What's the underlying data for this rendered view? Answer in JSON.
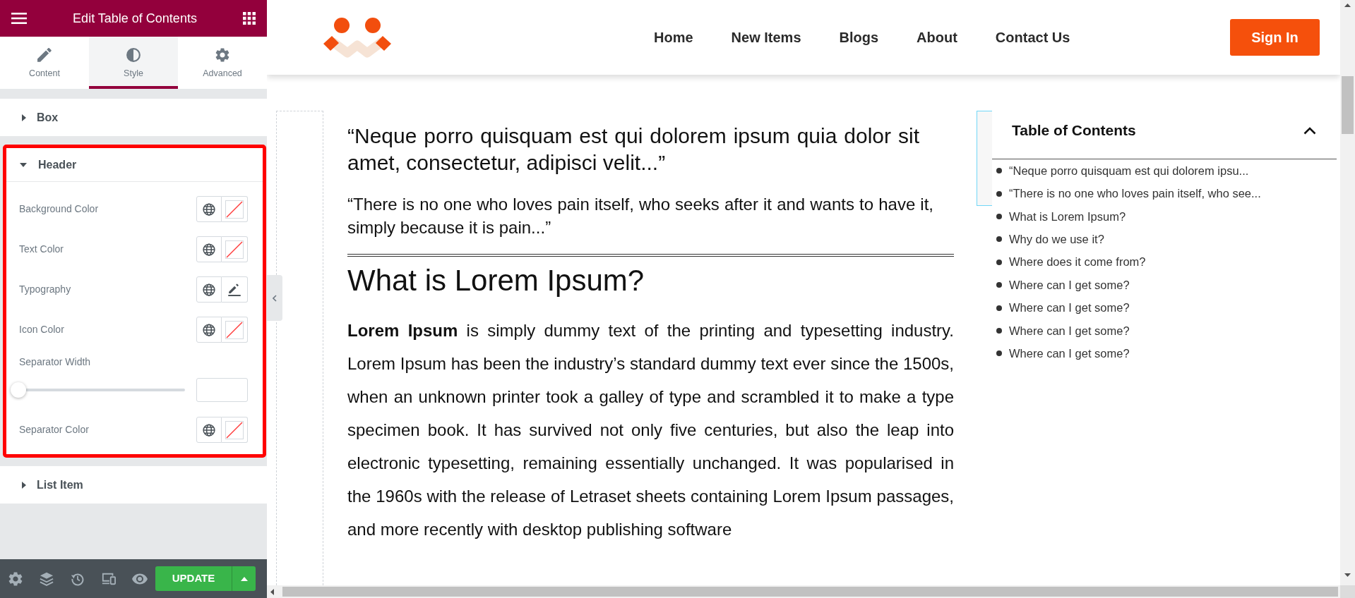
{
  "panel": {
    "title": "Edit Table of Contents",
    "tabs": [
      {
        "label": "Content",
        "selected": false
      },
      {
        "label": "Style",
        "selected": true
      },
      {
        "label": "Advanced",
        "selected": false
      }
    ],
    "sections": [
      {
        "title": "Box",
        "expanded": false,
        "highlighted": false
      },
      {
        "title": "Header",
        "expanded": true,
        "highlighted": true,
        "controls": [
          {
            "kind": "color",
            "label": "Background Color"
          },
          {
            "kind": "color",
            "label": "Text Color"
          },
          {
            "kind": "typography",
            "label": "Typography"
          },
          {
            "kind": "color",
            "label": "Icon Color"
          },
          {
            "kind": "slider",
            "label": "Separator Width",
            "level": 0
          },
          {
            "kind": "color",
            "label": "Separator Color"
          }
        ]
      },
      {
        "title": "List Item",
        "expanded": false,
        "highlighted": false
      }
    ],
    "update_button": "UPDATE"
  },
  "site_header": {
    "nav": [
      "Home",
      "New Items",
      "Blogs",
      "About",
      "Contact Us"
    ],
    "sign_in_button": "Sign In"
  },
  "article": {
    "lead_quote": "“Neque porro quisquam est qui dolorem ipsum quia dolor sit amet, consectetur, adipisci velit...”",
    "quote": "“There is no one who loves pain itself, who seeks after it and wants to have it, simply because it is pain...”",
    "heading": "What is Lorem Ipsum?",
    "paragraph": "**Lorem Ipsum** is simply dummy text of the printing and typesetting industry. Lorem Ipsum has been the industry’s standard dummy text ever since the 1500s, when an unknown printer took a galley of type and scrambled it to make a type specimen book. It has survived not only five centuries, but also the leap into electronic typesetting, remaining essentially unchanged. It was popularised in the 1960s with the release of Letraset sheets containing Lorem Ipsum passages, and more recently with desktop publishing software"
  },
  "toc": {
    "title": "Table of Contents",
    "expanded": true,
    "items": [
      "“Neque porro quisquam est qui dolorem ipsu...",
      "“There is no one who loves pain itself, who see...",
      "What is Lorem Ipsum?",
      "Why do we use it?",
      "Where does it come from?",
      "Where can I get some?",
      "Where can I get some?",
      "Where can I get some?",
      "Where can I get some?"
    ]
  }
}
